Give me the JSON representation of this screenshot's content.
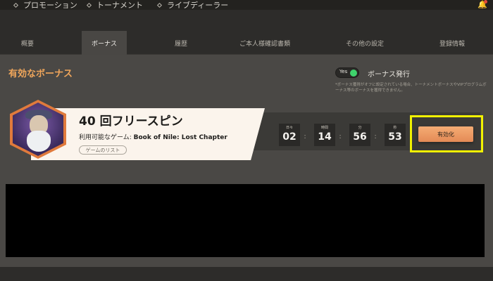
{
  "topnav": {
    "items": [
      {
        "label": "プロモーション"
      },
      {
        "label": "トーナメント"
      },
      {
        "label": "ライブディーラー"
      }
    ]
  },
  "tabs": [
    {
      "label": "概要"
    },
    {
      "label": "ボーナス"
    },
    {
      "label": "履歴"
    },
    {
      "label": "ご本人様確認書類"
    },
    {
      "label": "その他の設定"
    },
    {
      "label": "登録情報"
    }
  ],
  "active_tab": "ボーナス",
  "panel": {
    "title": "有効なボーナス",
    "toggle": {
      "state_label": "Yes",
      "text": "ボーナス発行"
    },
    "note": "*ボーナス獲得がオフに設定されている場合、トーナメントボーナスやVIPプログラムボーナス等のボーナスを獲得できません。"
  },
  "bonus": {
    "title": "40 回フリースピン",
    "games_prefix": "利用可能なゲーム: ",
    "games_value": "Book of Nile: Lost Chapter",
    "list_button": "ゲームのリスト",
    "timer": [
      {
        "label": "日々",
        "value": "02"
      },
      {
        "label": "時間",
        "value": "14"
      },
      {
        "label": "分",
        "value": "56"
      },
      {
        "label": "秒",
        "value": "53"
      }
    ],
    "colon": ":",
    "activate_label": "有効化"
  },
  "icons": {
    "nav_marker": "diamond-icon",
    "notification": "bell-icon",
    "avatar": "wizard-avatar-icon"
  },
  "colors": {
    "accent": "#f0a65b",
    "button": "#e48a56",
    "toggle_on": "#3fd36c",
    "highlight": "#f2f200"
  }
}
